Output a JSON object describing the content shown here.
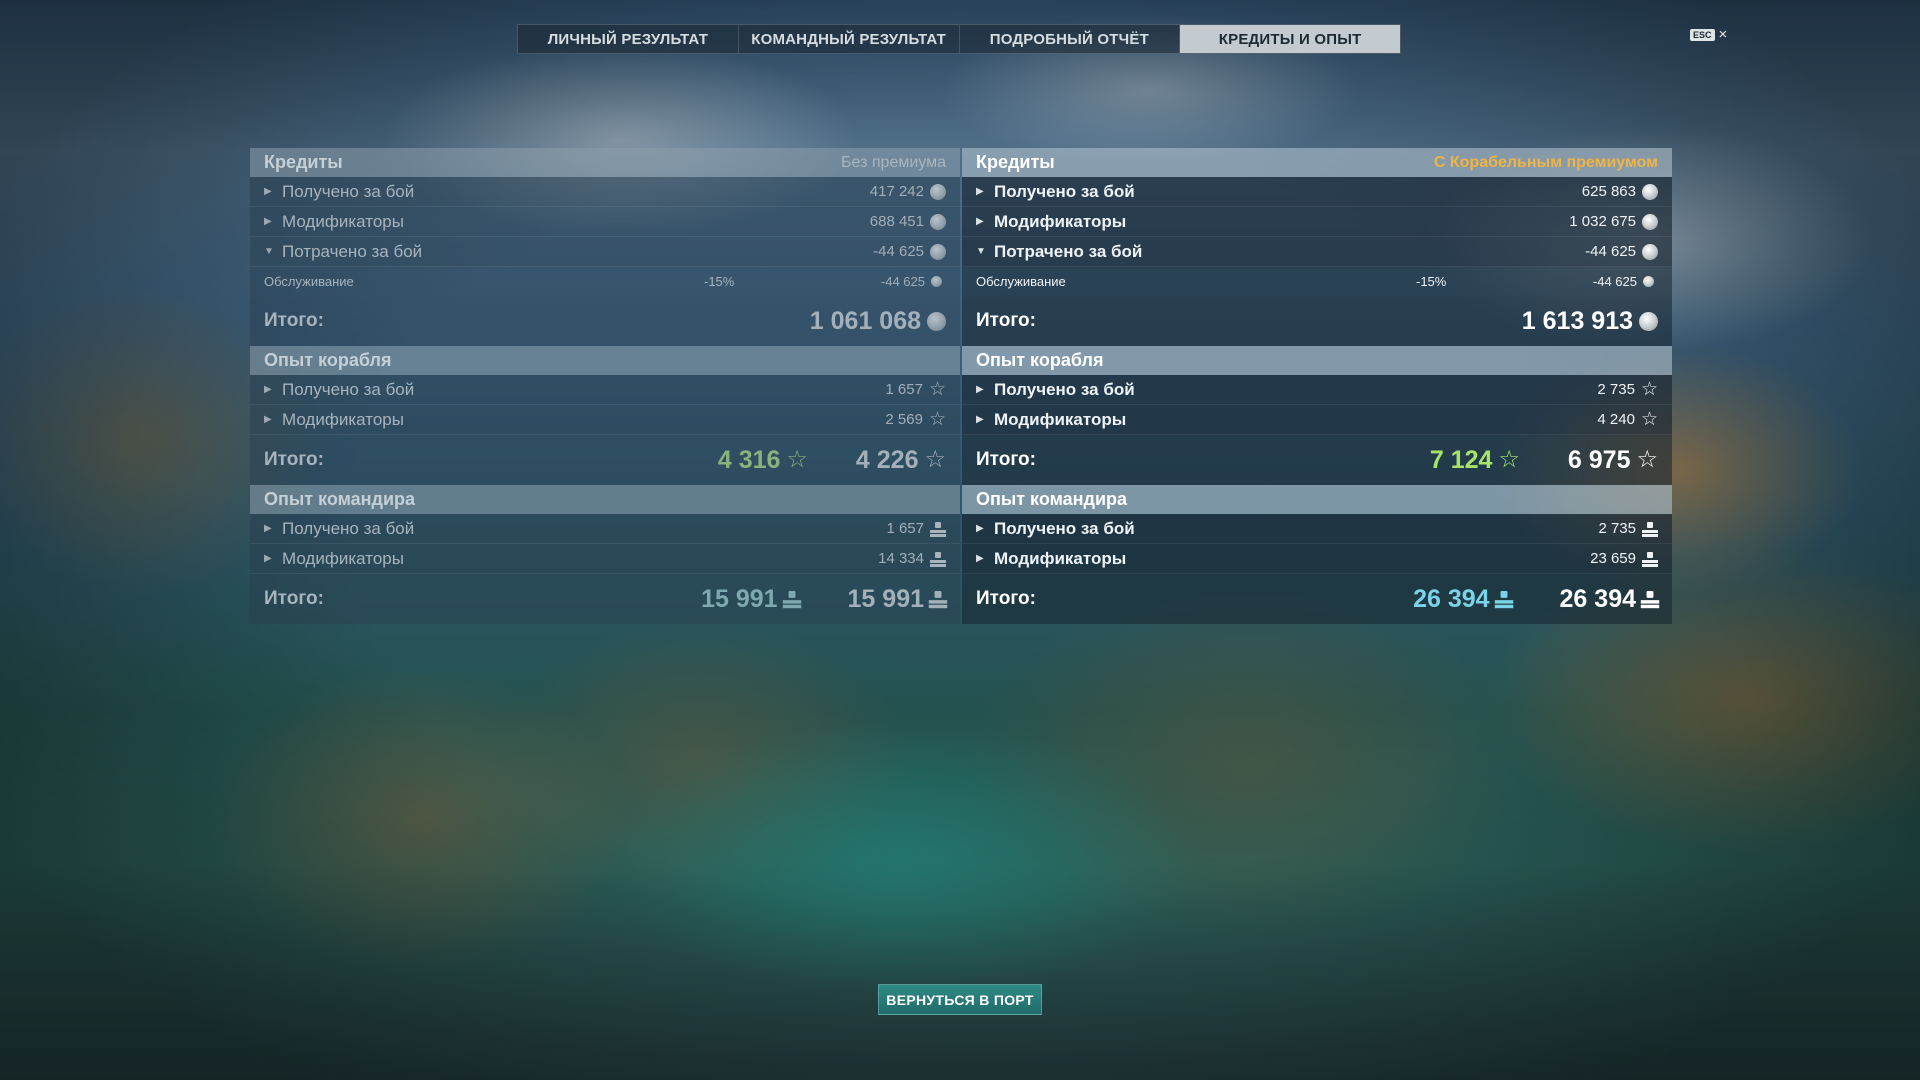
{
  "tabs": [
    {
      "label": "ЛИЧНЫЙ РЕЗУЛЬТАТ"
    },
    {
      "label": "КОМАНДНЫЙ РЕЗУЛЬТАТ"
    },
    {
      "label": "ПОДРОБНЫЙ ОТЧЁТ"
    },
    {
      "label": "КРЕДИТЫ И ОПЫТ",
      "active": true
    }
  ],
  "esc_label": "ESC",
  "close_glyph": "×",
  "left": {
    "credits": {
      "title": "Кредиты",
      "note": "Без премиума",
      "rows": [
        {
          "label": "Получено за бой",
          "value": "417 242"
        },
        {
          "label": "Модификаторы",
          "value": "688 451"
        },
        {
          "label": "Потрачено за бой",
          "value": "-44 625"
        }
      ],
      "sub": {
        "label": "Обслуживание",
        "pct": "-15%",
        "value": "-44 625"
      },
      "total_label": "Итого:",
      "total": "1 061 068"
    },
    "ship_xp": {
      "title": "Опыт корабля",
      "rows": [
        {
          "label": "Получено за бой",
          "value": "1 657"
        },
        {
          "label": "Модификаторы",
          "value": "2 569"
        }
      ],
      "total_label": "Итого:",
      "total_bonus": "4 316",
      "total": "4 226"
    },
    "commander_xp": {
      "title": "Опыт командира",
      "rows": [
        {
          "label": "Получено за бой",
          "value": "1 657"
        },
        {
          "label": "Модификаторы",
          "value": "14 334"
        }
      ],
      "total_label": "Итого:",
      "total_bonus": "15 991",
      "total": "15 991"
    }
  },
  "right": {
    "credits": {
      "title": "Кредиты",
      "note": "С Корабельным премиумом",
      "rows": [
        {
          "label": "Получено за бой",
          "value": "625 863"
        },
        {
          "label": "Модификаторы",
          "value": "1 032 675"
        },
        {
          "label": "Потрачено за бой",
          "value": "-44 625"
        }
      ],
      "sub": {
        "label": "Обслуживание",
        "pct": "-15%",
        "value": "-44 625"
      },
      "total_label": "Итого:",
      "total": "1 613 913"
    },
    "ship_xp": {
      "title": "Опыт корабля",
      "rows": [
        {
          "label": "Получено за бой",
          "value": "2 735"
        },
        {
          "label": "Модификаторы",
          "value": "4 240"
        }
      ],
      "total_label": "Итого:",
      "total_bonus": "7 124",
      "total": "6 975"
    },
    "commander_xp": {
      "title": "Опыт командира",
      "rows": [
        {
          "label": "Получено за бой",
          "value": "2 735"
        },
        {
          "label": "Модификаторы",
          "value": "23 659"
        }
      ],
      "total_label": "Итого:",
      "total_bonus": "26 394",
      "total": "26 394"
    }
  },
  "icons": {
    "credits": "coin-icon",
    "ship_xp": "star-icon",
    "commander_xp": "commander-cap-icon",
    "expanded": "triangle-down",
    "collapsed": "triangle-right"
  },
  "glyphs": {
    "star": "☆",
    "arrow_right": "▶",
    "arrow_down": "▼"
  },
  "colors": {
    "premium_note": "#f0b445",
    "xp_bonus_green": "#a9e46a",
    "commander_bonus_teal": "#7ad3e6",
    "button_teal": "#2f8a87"
  },
  "back_button": "ВЕРНУТЬСЯ В ПОРТ"
}
